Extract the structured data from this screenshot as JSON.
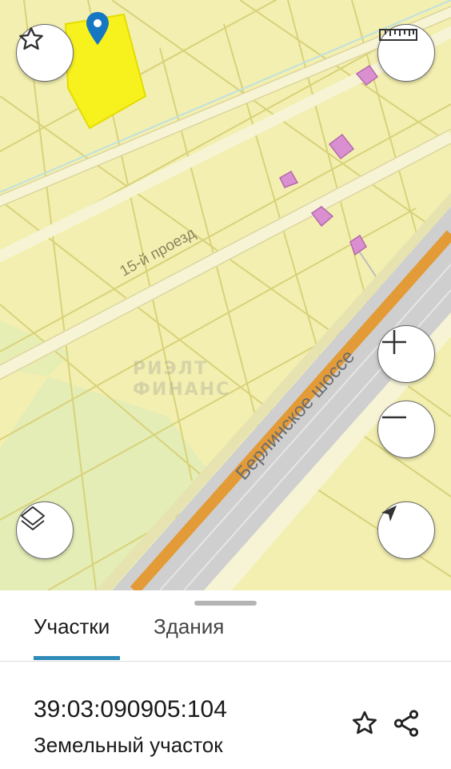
{
  "map": {
    "road_label_proezd": "15-й проезд",
    "road_label_shosse": "Берлинское шоссе",
    "watermark_line1": "РИЭЛТ",
    "watermark_line2": "ФИНАНС",
    "colors": {
      "background": "#f3efb0",
      "parcel_outline": "#d8d27a",
      "selected_parcel": "#f7f21e",
      "building": "#d98fd0",
      "highway_center": "#e39b37",
      "highway_outer": "#cfcfcf",
      "marker": "#1576c2"
    },
    "icons": {
      "favorite": "star-outline-icon",
      "ruler": "ruler-icon",
      "zoom_in": "plus-icon",
      "zoom_out": "minus-icon",
      "layers": "layers-icon",
      "locate": "navigation-arrow-icon",
      "marker": "map-pin-icon"
    }
  },
  "sheet": {
    "tabs": [
      {
        "label": "Участки",
        "active": true
      },
      {
        "label": "Здания",
        "active": false
      }
    ],
    "parcel": {
      "cadastral_number": "39:03:090905:104",
      "type": "Земельный участок"
    },
    "actions": {
      "favorite_icon": "star-outline-icon",
      "share_icon": "share-icon"
    },
    "accent_color": "#2e8bb8"
  }
}
